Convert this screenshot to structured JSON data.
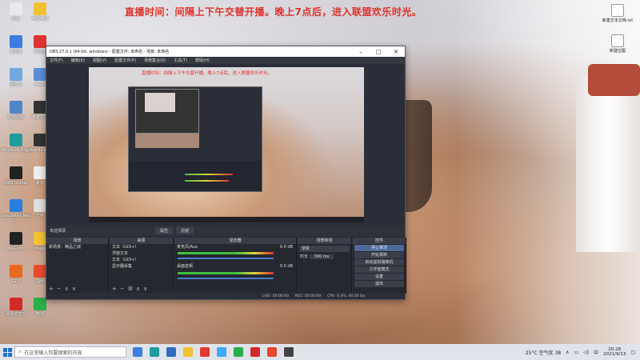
{
  "wallpaper_banner": "直播时间：间隔上下午交替开播。晚上7点后，进入联盟欢乐时光。",
  "desktop_icons_left": [
    {
      "label": "Mac",
      "color": "#e8e8ee"
    },
    {
      "label": "哔哩哔哩",
      "color": "#f2c233"
    },
    {
      "label": "此电脑",
      "color": "#3c7de0"
    },
    {
      "label": "网易云",
      "color": "#d33"
    },
    {
      "label": "回收站",
      "color": "#6fa8dc"
    },
    {
      "label": "Media",
      "color": "#5a8fd8"
    },
    {
      "label": "控制面板",
      "color": "#4f86c6"
    },
    {
      "label": "英雄联盟",
      "color": "#333"
    },
    {
      "label": "Microsoft Edge",
      "color": "#1f9c9c"
    },
    {
      "label": "Bandicam",
      "color": "#333"
    },
    {
      "label": "OBS Studio",
      "color": "#222"
    },
    {
      "label": "素材",
      "color": "#eee"
    },
    {
      "label": "GeoGebra Neo 2...",
      "color": "#2a7de1"
    },
    {
      "label": "文档",
      "color": "#ddd"
    },
    {
      "label": "WeGame",
      "color": "#222"
    },
    {
      "label": "Image",
      "color": "#f2c233"
    },
    {
      "label": "GPU",
      "color": "#e86a1f"
    },
    {
      "label": "福昕",
      "color": "#e84a2f"
    },
    {
      "label": "网易云音乐",
      "color": "#d42a2a"
    },
    {
      "label": "微信",
      "color": "#2aae4a"
    }
  ],
  "desktop_icons_right": [
    {
      "label": "新建文本文档.txt"
    },
    {
      "label": "新建位图"
    }
  ],
  "obs": {
    "title": "OBS 27.0.1 (64-bit, windows) - 配置文件: 未命名 - 场景: 未命名",
    "menu": [
      "文件(F)",
      "编辑(E)",
      "视图(V)",
      "配置文件(P)",
      "场景集合(S)",
      "工具(T)",
      "帮助(H)"
    ],
    "preview_banner": "直播时间：间隔上下午交替开播。晚上7点后，进入联盟欢乐时光。",
    "no_source_label": "未选择源",
    "props_button": "属性",
    "filters_button": "滤镜",
    "scenes_header": "场景",
    "scenes": [
      "新场景：精品之城"
    ],
    "sources_header": "来源",
    "sources": [
      "文本（GDI+）",
      "浮窗文本",
      "文本（GDI+）",
      "显示器采集"
    ],
    "mixer_header": "混音器",
    "mixer_channels": [
      {
        "name": "麦克风/Aux",
        "db": "0.0 dB"
      },
      {
        "name": "桌面音频",
        "db": "0.0 dB"
      }
    ],
    "transitions_header": "场景转场",
    "transition_value": "渐变",
    "duration_label": "时长",
    "duration_value": "300 ms",
    "controls_header": "控件",
    "controls": [
      "停止推流",
      "开始录制",
      "启动虚拟摄像机",
      "工作室模式",
      "设置",
      "退出"
    ],
    "status": [
      "LIVE: 00:00:00",
      "REC: 00:00:00",
      "CPU: 6.4%, 60.00 fps"
    ]
  },
  "taskbar": {
    "search_placeholder": "在这里输入你要搜索的内容",
    "weather": "25°C 空气优 38",
    "ime": "中",
    "time": "20:28",
    "date": "2021/9/13",
    "app_colors": [
      "#3c7de0",
      "#1f9c9c",
      "#2d6cc0",
      "#f2c233",
      "#e03a2e",
      "#3fa8f5",
      "#2aae4a",
      "#d42a2a",
      "#e84a2f",
      "#444"
    ]
  }
}
